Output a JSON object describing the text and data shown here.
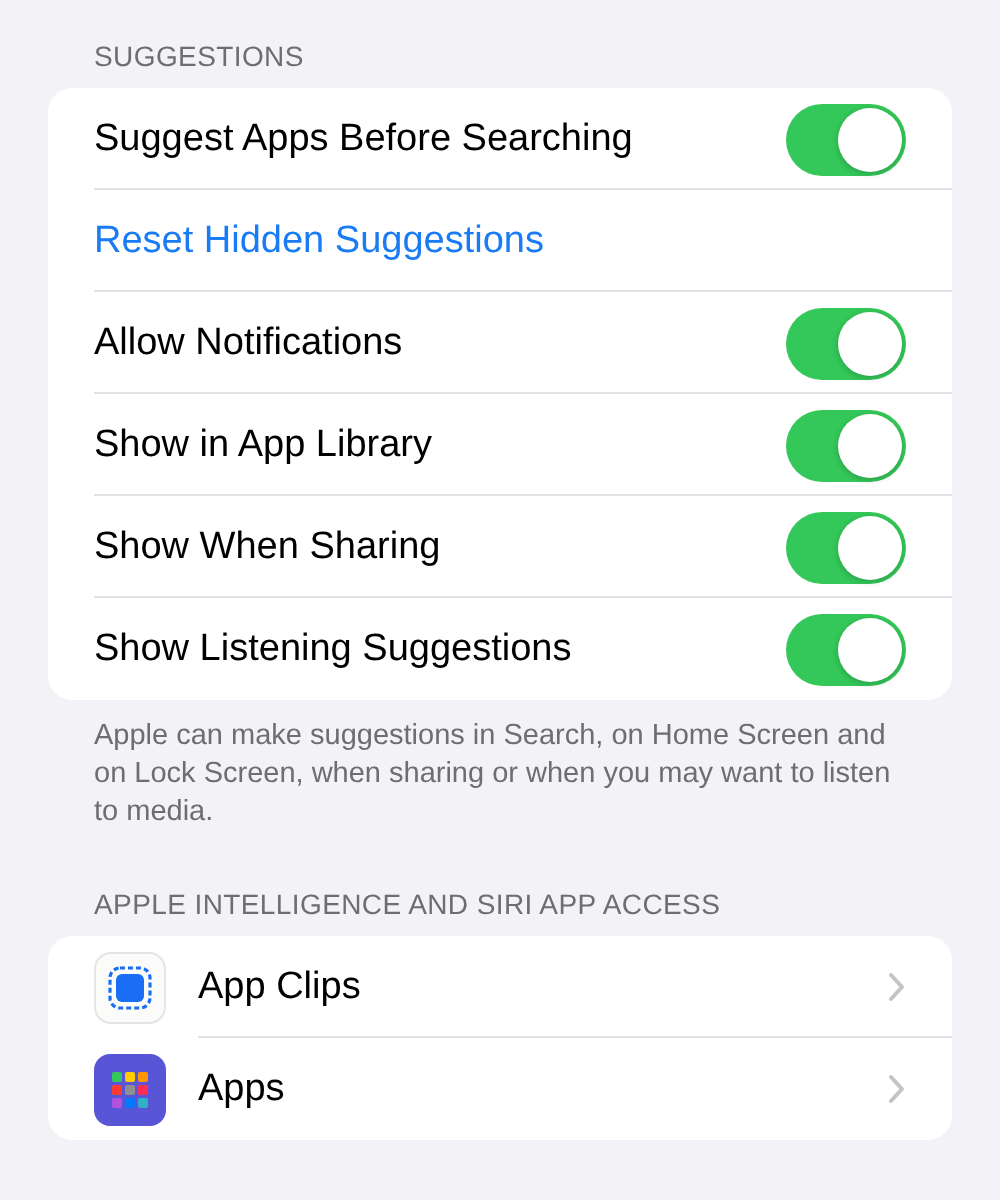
{
  "suggestions": {
    "header": "SUGGESTIONS",
    "rows": [
      {
        "kind": "toggle",
        "label": "Suggest Apps Before Searching",
        "on": true
      },
      {
        "kind": "link",
        "label": "Reset Hidden Suggestions"
      },
      {
        "kind": "toggle",
        "label": "Allow Notifications",
        "on": true
      },
      {
        "kind": "toggle",
        "label": "Show in App Library",
        "on": true
      },
      {
        "kind": "toggle",
        "label": "Show When Sharing",
        "on": true
      },
      {
        "kind": "toggle",
        "label": "Show Listening Suggestions",
        "on": true
      }
    ],
    "footer": "Apple can make suggestions in Search, on Home Screen and on Lock Screen, when sharing or when you may want to listen to media."
  },
  "access": {
    "header": "APPLE INTELLIGENCE AND SIRI APP ACCESS",
    "rows": [
      {
        "kind": "clips",
        "label": "App Clips"
      },
      {
        "kind": "apps",
        "label": "Apps"
      }
    ]
  }
}
